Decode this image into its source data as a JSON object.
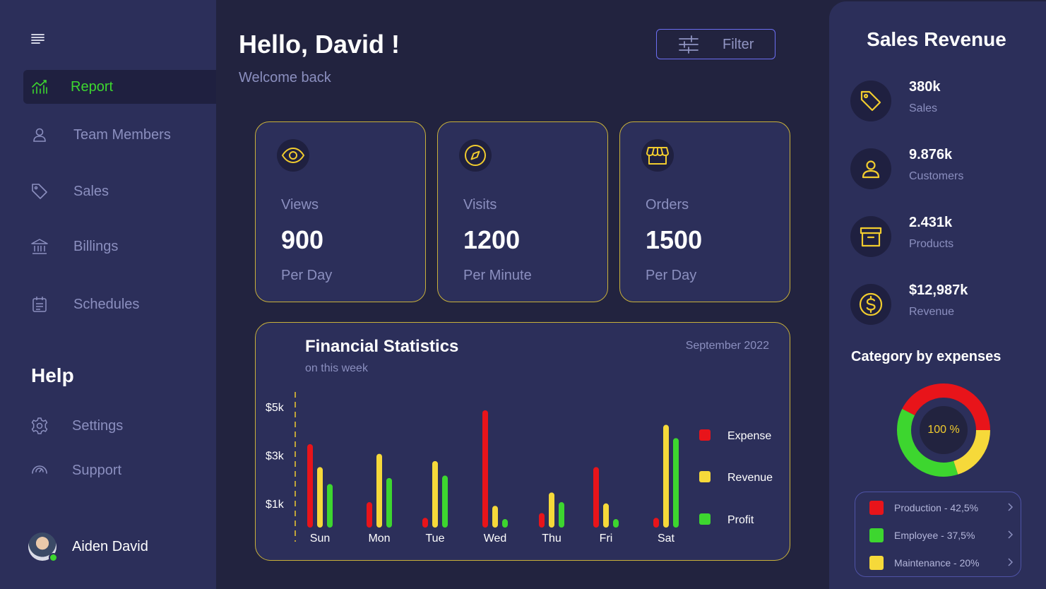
{
  "sidebar": {
    "menu_icon": "menu-icon",
    "items": [
      {
        "label": "Report",
        "icon": "chart-line-icon",
        "active": true
      },
      {
        "label": "Team Members",
        "icon": "user-icon"
      },
      {
        "label": "Sales",
        "icon": "tag-icon"
      },
      {
        "label": "Billings",
        "icon": "bank-icon"
      },
      {
        "label": "Schedules",
        "icon": "calendar-icon"
      }
    ],
    "help_title": "Help",
    "help_items": [
      {
        "label": "Settings",
        "icon": "gear-icon"
      },
      {
        "label": "Support",
        "icon": "support-icon"
      }
    ],
    "user": {
      "name": "Aiden David"
    }
  },
  "header": {
    "greeting": "Hello, David !",
    "welcome": "Welcome back",
    "filter_label": "Filter"
  },
  "stats": [
    {
      "name": "Views",
      "value": "900",
      "unit": "Per Day",
      "icon": "eye-icon"
    },
    {
      "name": "Visits",
      "value": "1200",
      "unit": "Per Minute",
      "icon": "compass-icon"
    },
    {
      "name": "Orders",
      "value": "1500",
      "unit": "Per Day",
      "icon": "store-icon"
    }
  ],
  "financial": {
    "title": "Financial Statistics",
    "subtitle": "on this week",
    "date": "September 2022"
  },
  "chart_data": {
    "type": "bar",
    "title": "Financial Statistics",
    "subtitle": "on this week",
    "categories": [
      "Sun",
      "Mon",
      "Tue",
      "Wed",
      "Thu",
      "Fri",
      "Sat"
    ],
    "y_ticks": [
      "$5k",
      "$3k",
      "$1k"
    ],
    "y_tick_values": [
      5,
      3,
      1
    ],
    "ylim": [
      0,
      5.2
    ],
    "units": "$k",
    "series": [
      {
        "name": "Expense",
        "color": "#e8141a",
        "values": [
          3.45,
          1.05,
          0.4,
          4.85,
          0.6,
          2.5,
          0.4
        ]
      },
      {
        "name": "Revenue",
        "color": "#f6d93a",
        "values": [
          2.5,
          3.05,
          2.75,
          0.9,
          1.45,
          1.0,
          4.25
        ]
      },
      {
        "name": "Profit",
        "color": "#3dd62f",
        "values": [
          1.8,
          2.05,
          2.15,
          0.35,
          1.05,
          0.35,
          3.7
        ]
      }
    ],
    "legend_position": "right",
    "grid": false
  },
  "right_panel": {
    "title": "Sales Revenue",
    "metrics": [
      {
        "value": "380k",
        "label": "Sales",
        "icon": "tag-icon"
      },
      {
        "value": "9.876k",
        "label": "Customers",
        "icon": "user-icon"
      },
      {
        "value": "2.431k",
        "label": "Products",
        "icon": "archive-box-icon"
      },
      {
        "value": "$12,987k",
        "label": "Revenue",
        "icon": "dollar-coin-icon"
      }
    ],
    "category_title": "Category by expenses",
    "donut_label": "100 %",
    "categories": [
      {
        "label": "Production - 42,5%",
        "percent": 42.5,
        "color": "#e8141a"
      },
      {
        "label": "Employee - 37,5%",
        "percent": 37.5,
        "color": "#3dd62f"
      },
      {
        "label": "Maintenance - 20%",
        "percent": 20,
        "color": "#f6d93a"
      }
    ]
  },
  "colors": {
    "background": "#22233f",
    "panel": "#2c2f5a",
    "accent_green": "#3dd62f",
    "accent_yellow": "#f1cc2e",
    "accent_red": "#e8141a",
    "muted_text": "#8b8fbf"
  }
}
